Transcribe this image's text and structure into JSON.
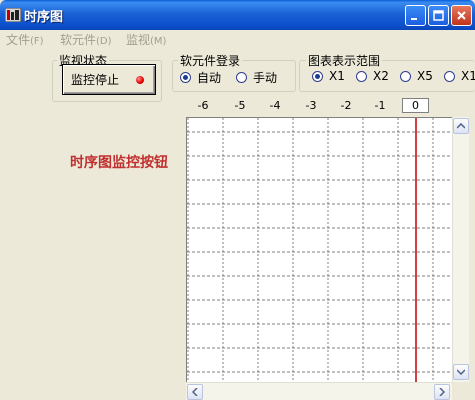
{
  "window": {
    "title": "时序图",
    "controls": {
      "minimize": "minimize-icon",
      "maximize": "maximize-icon",
      "close": "close-icon"
    }
  },
  "menu": [
    {
      "label": "文件",
      "accel": "(F)"
    },
    {
      "label": "软元件",
      "accel": "(D)"
    },
    {
      "label": "监视",
      "accel": "(M)"
    }
  ],
  "monitor_status": {
    "group_title": "监视状态",
    "button_label": "监控停止",
    "led_color": "#e00000"
  },
  "device_registration": {
    "group_title": "软元件登录",
    "options": [
      {
        "label": "自动",
        "selected": true
      },
      {
        "label": "手动",
        "selected": false
      }
    ]
  },
  "chart_range": {
    "group_title": "图表表示范围",
    "options": [
      {
        "label": "X1",
        "selected": true
      },
      {
        "label": "X2",
        "selected": false
      },
      {
        "label": "X5",
        "selected": false
      },
      {
        "label": "X1",
        "selected": false
      }
    ]
  },
  "side_label": "时序图监控按钮",
  "axis": {
    "ticks": [
      "-6",
      "-5",
      "-4",
      "-3",
      "-2",
      "-1"
    ],
    "current": "0",
    "cursor_color": "#c00000"
  }
}
